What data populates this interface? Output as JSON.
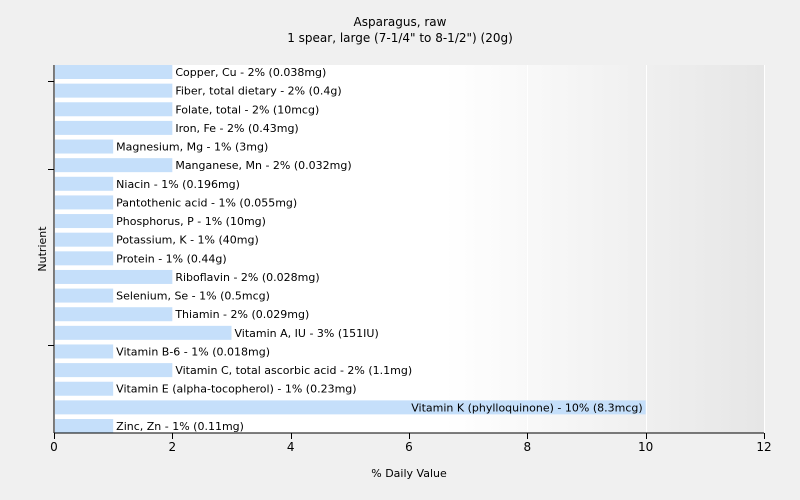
{
  "chart_data": {
    "type": "bar",
    "orientation": "horizontal",
    "title": "Asparagus, raw",
    "subtitle": "1 spear, large (7-1/4\" to 8-1/2\") (20g)",
    "xlabel": "% Daily Value",
    "ylabel": "Nutrient",
    "xlim": [
      0,
      12
    ],
    "xticks": [
      0,
      2,
      4,
      6,
      8,
      10,
      12
    ],
    "grid": false,
    "bar_color": "#c5dffa",
    "categories": [
      "Copper, Cu",
      "Fiber, total dietary",
      "Folate, total",
      "Iron, Fe",
      "Magnesium, Mg",
      "Manganese, Mn",
      "Niacin",
      "Pantothenic acid",
      "Phosphorus, P",
      "Potassium, K",
      "Protein",
      "Riboflavin",
      "Selenium, Se",
      "Thiamin",
      "Vitamin A, IU",
      "Vitamin B-6",
      "Vitamin C, total ascorbic acid",
      "Vitamin E (alpha-tocopherol)",
      "Vitamin K (phylloquinone)",
      "Zinc, Zn"
    ],
    "values": [
      2,
      2,
      2,
      2,
      1,
      2,
      1,
      1,
      1,
      1,
      1,
      2,
      1,
      2,
      3,
      1,
      2,
      1,
      10,
      1
    ],
    "data_labels": [
      "Copper, Cu - 2% (0.038mg)",
      "Fiber, total dietary - 2% (0.4g)",
      "Folate, total - 2% (10mcg)",
      "Iron, Fe - 2% (0.43mg)",
      "Magnesium, Mg - 1% (3mg)",
      "Manganese, Mn - 2% (0.032mg)",
      "Niacin - 1% (0.196mg)",
      "Pantothenic acid - 1% (0.055mg)",
      "Phosphorus, P - 1% (10mg)",
      "Potassium, K - 1% (40mg)",
      "Protein - 1% (0.44g)",
      "Riboflavin - 2% (0.028mg)",
      "Selenium, Se - 1% (0.5mcg)",
      "Thiamin - 2% (0.029mg)",
      "Vitamin A, IU - 3% (151IU)",
      "Vitamin B-6 - 1% (0.018mg)",
      "Vitamin C, total ascorbic acid - 2% (1.1mg)",
      "Vitamin E (alpha-tocopherol) - 1% (0.23mg)",
      "Vitamin K (phylloquinone) - 10% (8.3mcg)",
      "Zinc, Zn - 1% (0.11mg)"
    ]
  }
}
